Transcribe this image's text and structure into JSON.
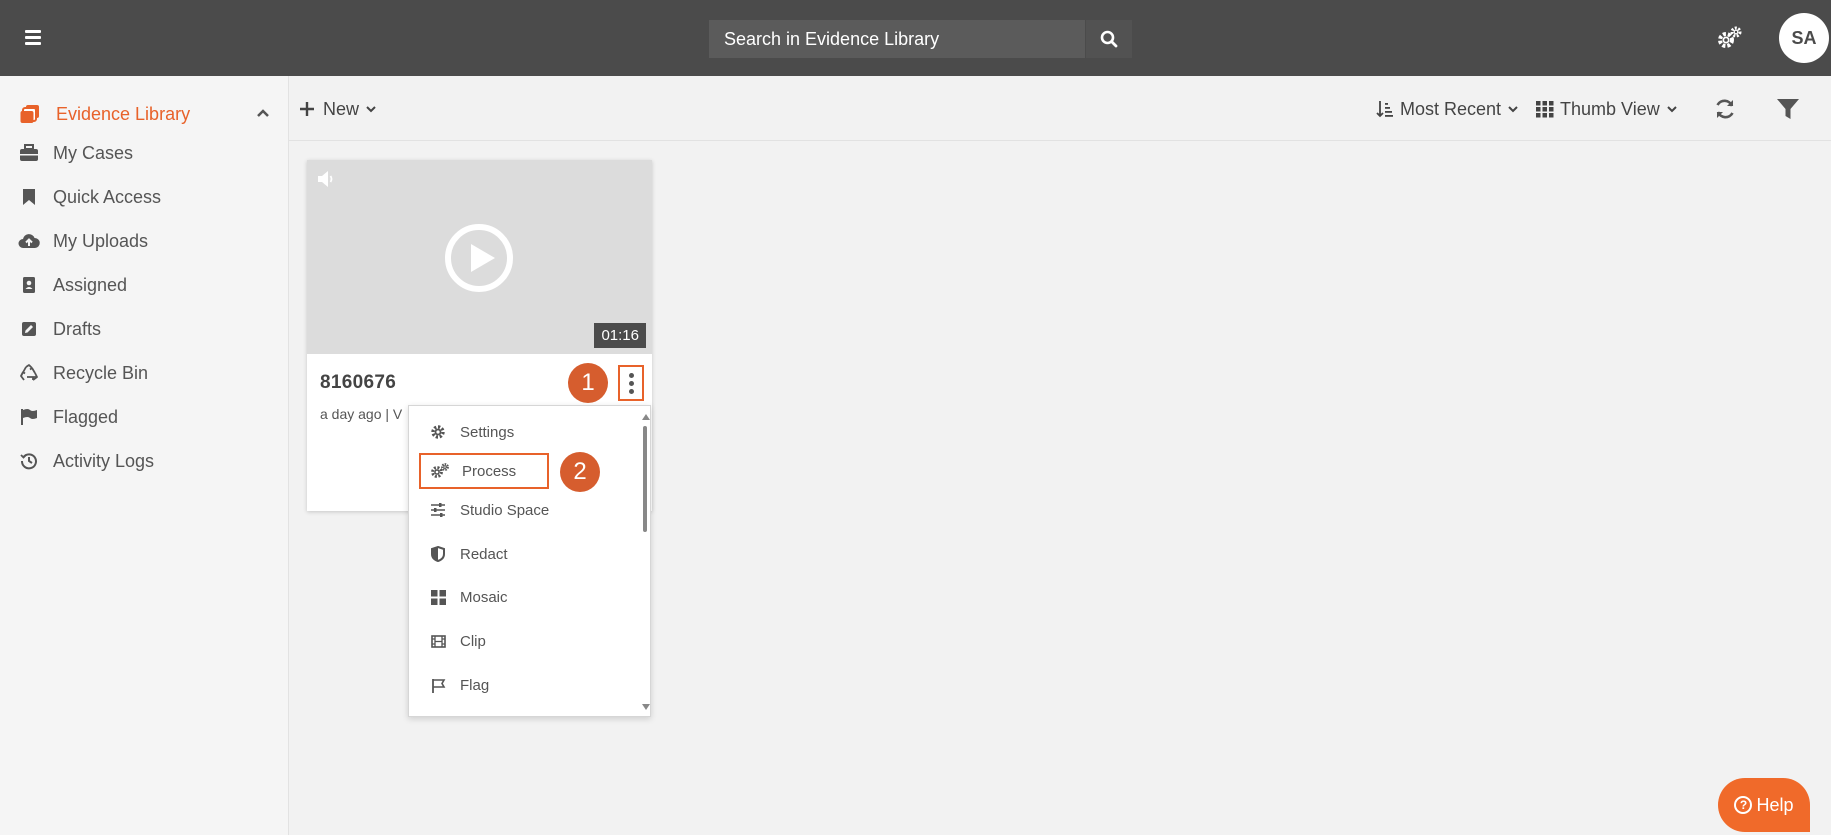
{
  "colors": {
    "accent": "#e8622a",
    "topbar": "#4b4b4b",
    "step_badge": "#d65d2e"
  },
  "search": {
    "placeholder": "Search in Evidence Library"
  },
  "user": {
    "initials": "SA"
  },
  "sidebar": {
    "header": {
      "label": "Evidence Library",
      "icon": "library-icon"
    },
    "items": [
      {
        "label": "My Cases",
        "icon": "briefcase-icon"
      },
      {
        "label": "Quick Access",
        "icon": "bookmark-icon"
      },
      {
        "label": "My Uploads",
        "icon": "cloud-upload-icon"
      },
      {
        "label": "Assigned",
        "icon": "assigned-icon"
      },
      {
        "label": "Drafts",
        "icon": "edit-icon"
      },
      {
        "label": "Recycle Bin",
        "icon": "recycle-icon"
      },
      {
        "label": "Flagged",
        "icon": "flag-icon"
      },
      {
        "label": "Activity Logs",
        "icon": "history-icon"
      }
    ]
  },
  "toolbar": {
    "new_label": "New",
    "sort_label": "Most Recent",
    "view_label": "Thumb View"
  },
  "card": {
    "title": "8160676",
    "meta": "a day ago  |  V",
    "duration": "01:16"
  },
  "menu": {
    "items": [
      {
        "label": "Settings",
        "icon": "gear-icon"
      },
      {
        "label": "Process",
        "icon": "gears-icon"
      },
      {
        "label": "Studio Space",
        "icon": "sliders-icon"
      },
      {
        "label": "Redact",
        "icon": "shield-icon"
      },
      {
        "label": "Mosaic",
        "icon": "grid-icon"
      },
      {
        "label": "Clip",
        "icon": "film-icon"
      },
      {
        "label": "Flag",
        "icon": "flag-outline-icon"
      }
    ]
  },
  "steps": {
    "one": "1",
    "two": "2"
  },
  "help": {
    "label": "Help"
  }
}
